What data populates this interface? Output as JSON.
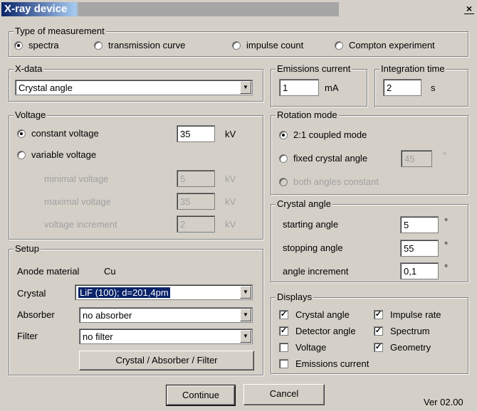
{
  "window": {
    "title": "X-ray device",
    "close_glyph": "×"
  },
  "measurement": {
    "legend": "Type of measurement",
    "options": [
      {
        "label": "spectra",
        "selected": true
      },
      {
        "label": "transmission curve",
        "selected": false
      },
      {
        "label": "impulse count",
        "selected": false
      },
      {
        "label": "Compton experiment",
        "selected": false
      }
    ]
  },
  "xdata": {
    "legend": "X-data",
    "value": "Crystal angle"
  },
  "emissions_current": {
    "legend": "Emissions current",
    "value": "1",
    "unit": "mA"
  },
  "integration_time": {
    "legend": "Integration time",
    "value": "2",
    "unit": "s"
  },
  "voltage": {
    "legend": "Voltage",
    "constant_label": "constant voltage",
    "constant_value": "35",
    "constant_unit": "kV",
    "variable_label": "variable voltage",
    "minimal_label": "minimal voltage",
    "minimal_value": "5",
    "minimal_unit": "kV",
    "maximal_label": "maximal voltage",
    "maximal_value": "35",
    "maximal_unit": "kV",
    "increment_label": "voltage increment",
    "increment_value": "2",
    "increment_unit": "kV"
  },
  "rotation": {
    "legend": "Rotation mode",
    "coupled_label": "2:1 coupled mode",
    "fixed_label": "fixed crystal angle",
    "fixed_value": "45",
    "fixed_unit": "°",
    "both_label": "both angles constant"
  },
  "crystal_angle": {
    "legend": "Crystal angle",
    "start_label": "starting angle",
    "start_value": "5",
    "start_unit": "°",
    "stop_label": "stopping angle",
    "stop_value": "55",
    "stop_unit": "°",
    "inc_label": "angle increment",
    "inc_value": "0,1",
    "inc_unit": "°"
  },
  "setup": {
    "legend": "Setup",
    "anode_label": "Anode material",
    "anode_value": "Cu",
    "crystal_label": "Crystal",
    "crystal_value": "LiF (100); d=201,4pm",
    "absorber_label": "Absorber",
    "absorber_value": "no absorber",
    "filter_label": "Filter",
    "filter_value": "no filter",
    "button": "Crystal / Absorber / Filter"
  },
  "displays": {
    "legend": "Displays",
    "items": [
      {
        "label": "Crystal angle",
        "checked": true
      },
      {
        "label": "Impulse rate",
        "checked": true
      },
      {
        "label": "Detector angle",
        "checked": true
      },
      {
        "label": "Spectrum",
        "checked": true
      },
      {
        "label": "Voltage",
        "checked": false
      },
      {
        "label": "Geometry",
        "checked": true
      },
      {
        "label": "Emissions current",
        "checked": false
      }
    ]
  },
  "footer": {
    "continue": "Continue",
    "cancel": "Cancel",
    "version": "Ver 02.00"
  }
}
